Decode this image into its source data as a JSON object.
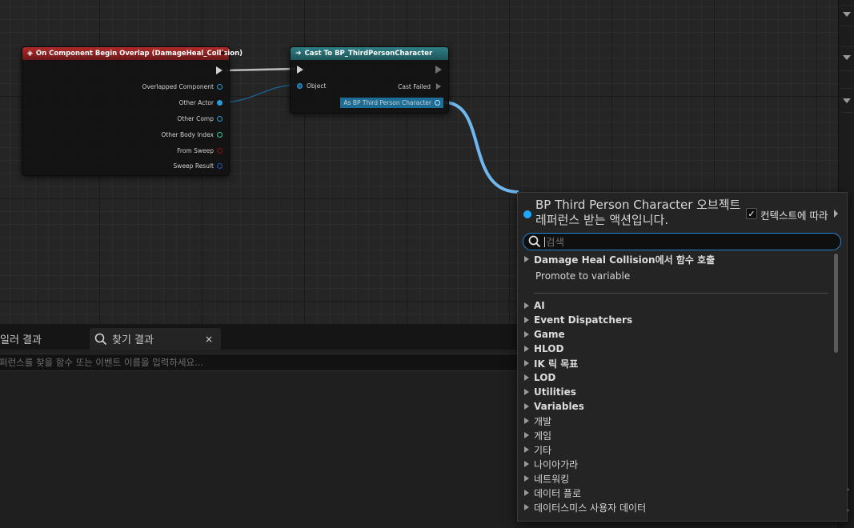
{
  "graph": {
    "nodes": {
      "overlap": {
        "title": "On Component Begin Overlap (DamageHeal_Collision)",
        "pins": [
          {
            "label": "Overlapped Component",
            "color": "#2a9bd6"
          },
          {
            "label": "Other Actor",
            "color": "#2a9bd6"
          },
          {
            "label": "Other Comp",
            "color": "#2a9bd6"
          },
          {
            "label": "Other Body Index",
            "color": "#2fce9b"
          },
          {
            "label": "From Sweep",
            "color": "#8b1515"
          },
          {
            "label": "Sweep Result",
            "color": "#1f59b8"
          }
        ]
      },
      "cast": {
        "title": "Cast To BP_ThirdPersonCharacter",
        "object_pin": "Object",
        "cast_failed": "Cast Failed",
        "as_pin": "As BP Third Person Character"
      }
    }
  },
  "bottom": {
    "tabs": {
      "compiler": "일러 결과",
      "find": "찾기 결과",
      "close": "×"
    },
    "find_placeholder": "퍼런스를 찾을 함수 또는 이벤트 이름을 입력하세요..."
  },
  "menu": {
    "title": "BP Third Person Character 오브젝트 레퍼런스 받는 액션입니다.",
    "context_label": "컨텍스트에 따라",
    "context_checked": true,
    "search_placeholder": "검색",
    "top_items": [
      {
        "label": "Damage Heal Collision에서 함수 호출",
        "expandable": true
      },
      {
        "label": "Promote to variable",
        "expandable": false
      }
    ],
    "categories": [
      "AI",
      "Event Dispatchers",
      "Game",
      "HLOD",
      "IK 릭 목표",
      "LOD",
      "Utilities",
      "Variables",
      "개발",
      "게임",
      "기타",
      "나이아가라",
      "네트워킹",
      "데이터 플로",
      "데이터스미스 사용자 데이터"
    ]
  },
  "colors": {
    "accent": "#1ea7ff",
    "header_red": "#9c2323",
    "header_teal": "#2a747a",
    "wire_object": "#6fb8ef"
  }
}
